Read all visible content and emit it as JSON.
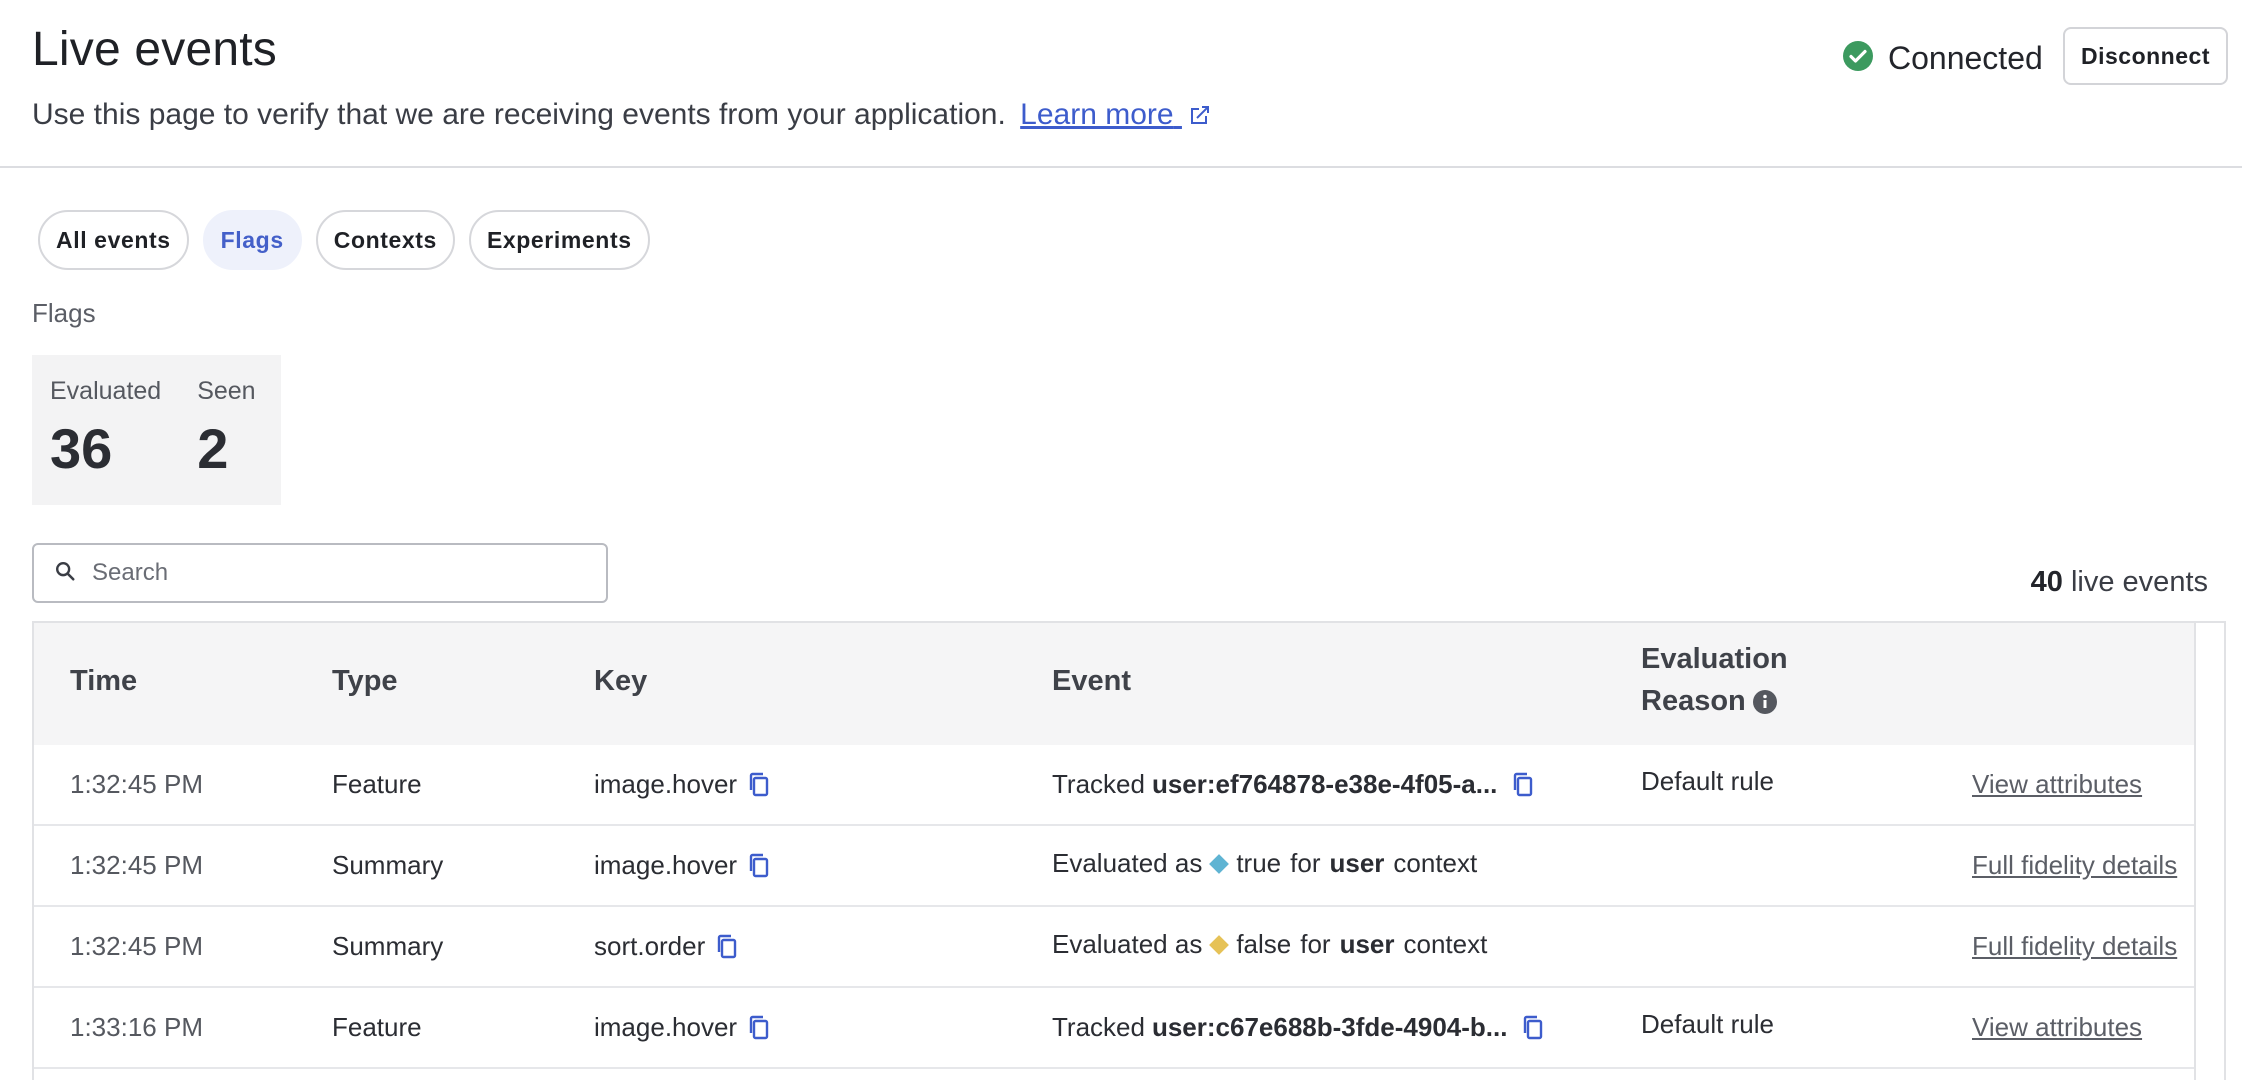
{
  "header": {
    "title": "Live events",
    "subtitle": "Use this page to verify that we are receiving events from your application.",
    "learn_more": "Learn more",
    "status": "Connected",
    "disconnect": "Disconnect"
  },
  "tabs": [
    {
      "label": "All events",
      "active": false
    },
    {
      "label": "Flags",
      "active": true
    },
    {
      "label": "Contexts",
      "active": false
    },
    {
      "label": "Experiments",
      "active": false
    }
  ],
  "section_label": "Flags",
  "stats": {
    "evaluated_label": "Evaluated",
    "evaluated_value": "36",
    "seen_label": "Seen",
    "seen_value": "2"
  },
  "search": {
    "placeholder": "Search",
    "value": ""
  },
  "live_count": {
    "number": "40",
    "label": "live events"
  },
  "table": {
    "columns": [
      "Time",
      "Type",
      "Key",
      "Event",
      "Evaluation",
      "Reason"
    ],
    "rows": [
      {
        "time": "1:32:45 PM",
        "type": "Feature",
        "key": "image.hover",
        "event_prefix": "Tracked",
        "event_bold": "user:ef764878-e38e-4f05-a...",
        "reason": "Default rule",
        "action": "View attributes"
      },
      {
        "time": "1:32:45 PM",
        "type": "Summary",
        "key": "image.hover",
        "eval_prefix": "Evaluated as",
        "eval_value": "true",
        "eval_for": "for",
        "eval_ctx": "user",
        "eval_suffix": "context",
        "action": "Full fidelity details"
      },
      {
        "time": "1:32:45 PM",
        "type": "Summary",
        "key": "sort.order",
        "eval_prefix": "Evaluated as",
        "eval_value": "false",
        "eval_for": "for",
        "eval_ctx": "user",
        "eval_suffix": "context",
        "action": "Full fidelity details"
      },
      {
        "time": "1:33:16 PM",
        "type": "Feature",
        "key": "image.hover",
        "event_prefix": "Tracked",
        "event_bold": "user:c67e688b-3fde-4904-b...",
        "reason": "Default rule",
        "action": "View attributes"
      }
    ]
  },
  "colors": {
    "accent": "#3d5ccc",
    "connected_green": "#3c9a5f",
    "true_variation": "#5fb4d3",
    "false_variation": "#e6c257"
  }
}
